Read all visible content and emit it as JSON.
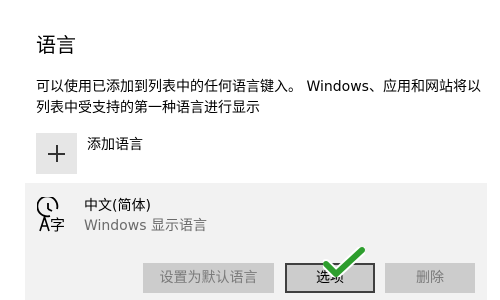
{
  "page": {
    "title": "语言",
    "description": "可以使用已添加到列表中的任何语言键入。 Windows、应用和网站将以列表中受支持的第一种语言进行显示"
  },
  "add_language": {
    "label": "添加语言",
    "icon": "plus-icon"
  },
  "language_item": {
    "name": "中文(简体)",
    "subtitle": "Windows 显示语言",
    "icon": "language-icon",
    "icon_glyph": "字"
  },
  "buttons": {
    "set_default": "设置为默认语言",
    "options": "选项",
    "remove": "删除"
  },
  "annotation": {
    "icon": "checkmark-icon",
    "color": "#2e9e2e"
  }
}
